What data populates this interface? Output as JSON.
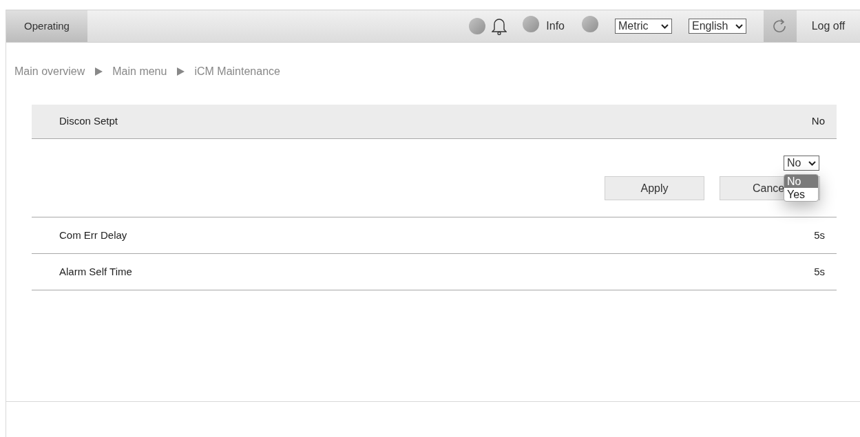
{
  "header": {
    "mode_tab": "Operating",
    "info_label": "Info",
    "unit_select": {
      "value": "Metric"
    },
    "language_select": {
      "value": "English"
    },
    "logoff": "Log off"
  },
  "breadcrumb": [
    "Main overview",
    "Main menu",
    "iCM Maintenance"
  ],
  "settings": [
    {
      "label": "Discon Setpt",
      "value": "No",
      "expanded": true
    },
    {
      "label": "Com Err Delay",
      "value": "5s",
      "expanded": false
    },
    {
      "label": "Alarm Self Time",
      "value": "5s",
      "expanded": false
    }
  ],
  "editor": {
    "select_value": "No",
    "options": [
      {
        "label": "No",
        "selected": true
      },
      {
        "label": "Yes",
        "selected": false
      }
    ],
    "apply": "Apply",
    "cancel": "Cance"
  }
}
